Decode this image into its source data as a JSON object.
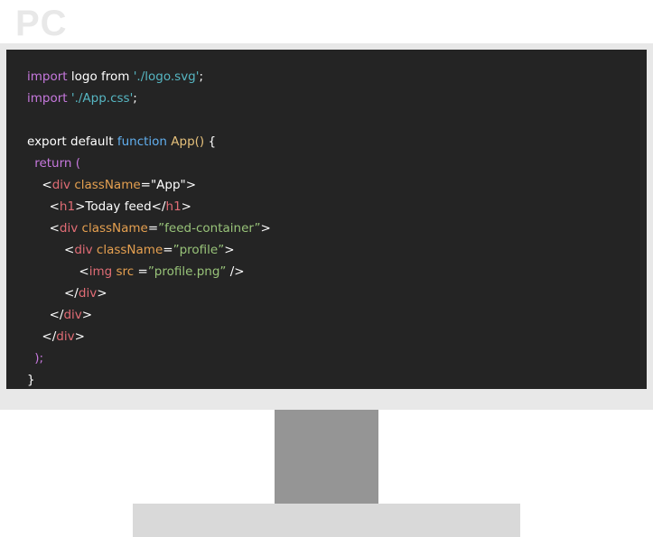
{
  "header": {
    "title": "PC"
  },
  "colors": {
    "keyword": "#c678dd",
    "string": "#56b6c2",
    "fn_keyword": "#61afef",
    "fn_name": "#e5c07b",
    "tag": "#e06c75",
    "attr": "#e5a050",
    "value": "#98c379",
    "text": "#ffffff"
  },
  "code": {
    "lines": [
      {
        "indent": 0,
        "tokens": [
          {
            "t": "import",
            "c": "keyword"
          },
          {
            "t": " logo from ",
            "c": "text"
          },
          {
            "t": "'./logo.svg'",
            "c": "string"
          },
          {
            "t": ";",
            "c": "text"
          }
        ]
      },
      {
        "indent": 0,
        "tokens": [
          {
            "t": "import",
            "c": "keyword"
          },
          {
            "t": " ",
            "c": "text"
          },
          {
            "t": "'./App.css'",
            "c": "string"
          },
          {
            "t": ";",
            "c": "text"
          }
        ]
      },
      {
        "indent": 0,
        "tokens": []
      },
      {
        "indent": 0,
        "tokens": [
          {
            "t": "export default ",
            "c": "text"
          },
          {
            "t": "function",
            "c": "fn_keyword"
          },
          {
            "t": " ",
            "c": "text"
          },
          {
            "t": "App()",
            "c": "fn_name"
          },
          {
            "t": " {",
            "c": "text"
          }
        ]
      },
      {
        "indent": 1,
        "tokens": [
          {
            "t": "return (",
            "c": "keyword"
          }
        ]
      },
      {
        "indent": 2,
        "tokens": [
          {
            "t": "<",
            "c": "text"
          },
          {
            "t": "div",
            "c": "tag"
          },
          {
            "t": " ",
            "c": "text"
          },
          {
            "t": "className",
            "c": "attr"
          },
          {
            "t": "=\"App\">",
            "c": "text"
          }
        ]
      },
      {
        "indent": 3,
        "tokens": [
          {
            "t": "<",
            "c": "text"
          },
          {
            "t": "h1",
            "c": "tag"
          },
          {
            "t": ">Today feed</",
            "c": "text"
          },
          {
            "t": "h1",
            "c": "tag"
          },
          {
            "t": ">",
            "c": "text"
          }
        ]
      },
      {
        "indent": 3,
        "tokens": [
          {
            "t": "<",
            "c": "text"
          },
          {
            "t": "div",
            "c": "tag"
          },
          {
            "t": " ",
            "c": "text"
          },
          {
            "t": "className",
            "c": "attr"
          },
          {
            "t": "=",
            "c": "text"
          },
          {
            "t": "”feed-container”",
            "c": "value"
          },
          {
            "t": ">",
            "c": "text"
          }
        ]
      },
      {
        "indent": 5,
        "tokens": [
          {
            "t": "<",
            "c": "text"
          },
          {
            "t": "div",
            "c": "tag"
          },
          {
            "t": " ",
            "c": "text"
          },
          {
            "t": "className",
            "c": "attr"
          },
          {
            "t": "=",
            "c": "text"
          },
          {
            "t": "”profile”",
            "c": "value"
          },
          {
            "t": ">",
            "c": "text"
          }
        ]
      },
      {
        "indent": 7,
        "tokens": [
          {
            "t": "<",
            "c": "text"
          },
          {
            "t": "img",
            "c": "tag"
          },
          {
            "t": " ",
            "c": "text"
          },
          {
            "t": "src",
            "c": "attr"
          },
          {
            "t": " =",
            "c": "text"
          },
          {
            "t": "”profile.png”",
            "c": "value"
          },
          {
            "t": " />",
            "c": "text"
          }
        ]
      },
      {
        "indent": 5,
        "tokens": [
          {
            "t": "</",
            "c": "text"
          },
          {
            "t": "div",
            "c": "tag"
          },
          {
            "t": ">",
            "c": "text"
          }
        ]
      },
      {
        "indent": 3,
        "tokens": [
          {
            "t": "</",
            "c": "text"
          },
          {
            "t": "div",
            "c": "tag"
          },
          {
            "t": ">",
            "c": "text"
          }
        ]
      },
      {
        "indent": 2,
        "tokens": [
          {
            "t": "</",
            "c": "text"
          },
          {
            "t": "div",
            "c": "tag"
          },
          {
            "t": ">",
            "c": "text"
          }
        ]
      },
      {
        "indent": 1,
        "tokens": [
          {
            "t": ");",
            "c": "keyword"
          }
        ]
      },
      {
        "indent": 0,
        "tokens": [
          {
            "t": "}",
            "c": "text"
          }
        ]
      }
    ]
  }
}
